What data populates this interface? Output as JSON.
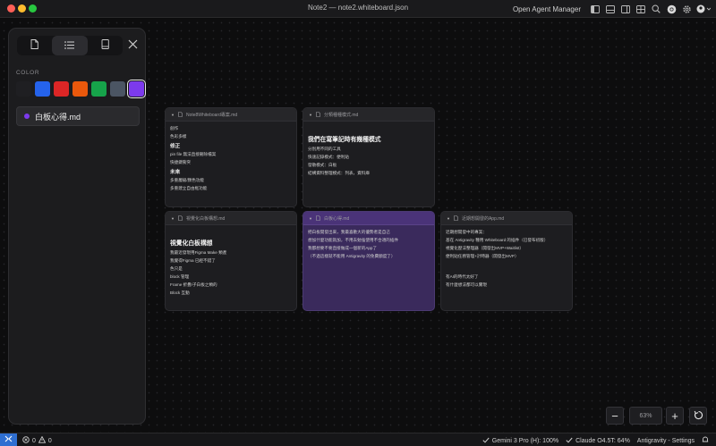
{
  "window": {
    "title": "Note2 — note2.whiteboard.json",
    "agent_manager_label": "Open Agent Manager"
  },
  "panel": {
    "tabs": [
      {
        "icon": "file-icon"
      },
      {
        "icon": "list-icon"
      },
      {
        "icon": "book-icon"
      }
    ],
    "color_label": "COLOR",
    "colors": [
      "#1f1f22",
      "#2563eb",
      "#dc2626",
      "#ea580c",
      "#16a34a",
      "#4b5563",
      "#7c3aed"
    ],
    "selected_color": "#7c3aed",
    "file": {
      "label": "白板心得.md",
      "dot_color": "#7c3aed"
    }
  },
  "notes": [
    {
      "title": "Note8Whiteboard專案.md",
      "lines": [
        {
          "t": "nl",
          "text": "創作"
        },
        {
          "t": "nl",
          "text": "色彩多樣"
        },
        {
          "t": "nh2",
          "text": "修正"
        },
        {
          "t": "nl",
          "text": "pin file 無法直接刪除檔案"
        },
        {
          "t": "nl",
          "text": "快捷鍵衝突"
        },
        {
          "t": "nh2",
          "text": "未來"
        },
        {
          "t": "nl",
          "text": "多重層級/顏色功能"
        },
        {
          "t": "nl",
          "text": "多重建立自由框功能"
        }
      ]
    },
    {
      "title": "分類種種模式.md",
      "lines": [
        {
          "t": "gap",
          "text": ""
        },
        {
          "t": "nh",
          "text": "我們在寫筆記時有幾種模式"
        },
        {
          "t": "nl",
          "text": "分別用不同的工具"
        },
        {
          "t": "nl",
          "text": "快速記錄模式：便利貼"
        },
        {
          "t": "nl",
          "text": "發散模式：白板"
        },
        {
          "t": "nl",
          "text": "結構資料整理模式：列表，資料庫"
        }
      ]
    },
    {
      "title": "視覺化白板構想.md",
      "lines": [
        {
          "t": "gap",
          "text": ""
        },
        {
          "t": "nh",
          "text": "視覺化白板構想"
        },
        {
          "t": "nl",
          "text": "我最近發現用Figma Make 類產"
        },
        {
          "t": "nl",
          "text": "我覺得Figma 已經不錯了"
        },
        {
          "t": "nl",
          "text": "色只是"
        },
        {
          "t": "nl",
          "text": "block 管理"
        },
        {
          "t": "nl",
          "text": "Frame 折疊/子白板之類的"
        },
        {
          "t": "nl",
          "text": "Block 互動"
        }
      ]
    },
    {
      "title": "白板心得.md",
      "purple": true,
      "lines": [
        {
          "t": "nl",
          "text": "把白板開發出來，我最喜歡大的優勢者是自己"
        },
        {
          "t": "nl",
          "text": "想加什麼功能就加，不用去勉強使用不合適的插件"
        },
        {
          "t": "nl",
          "text": "我都想要不要直接做成一個新的App了"
        },
        {
          "t": "nl",
          "text": "（不過這樣就不能用 Antigravity 的免費額度了）"
        }
      ]
    },
    {
      "title": "近期想開發的App.md",
      "lines": [
        {
          "t": "nl",
          "text": "近期想開發中的專案："
        },
        {
          "t": "nl",
          "text": "基在 Antigravity 種用 Whiteboard 的插件（已發布初版）"
        },
        {
          "t": "nl",
          "text": "視覺化歷法整理器（開發出MVP+Waitlist）"
        },
        {
          "t": "nl",
          "text": "便利貼任務管理+計時器（開發出MVP）"
        },
        {
          "t": "gap",
          "text": ""
        },
        {
          "t": "gap",
          "text": ""
        },
        {
          "t": "nl",
          "text": "有AI的時代太好了"
        },
        {
          "t": "nl",
          "text": "有什麼想法都可以實現"
        }
      ]
    }
  ],
  "zoom": {
    "minus": "−",
    "value": "63%",
    "plus": "+"
  },
  "status": {
    "errors": "0",
    "warnings": "0",
    "gemini": "Gemini 3 Pro (H): 100%",
    "claude": "Claude O4.5T: 64%",
    "settings": "Antigravity - Settings"
  }
}
